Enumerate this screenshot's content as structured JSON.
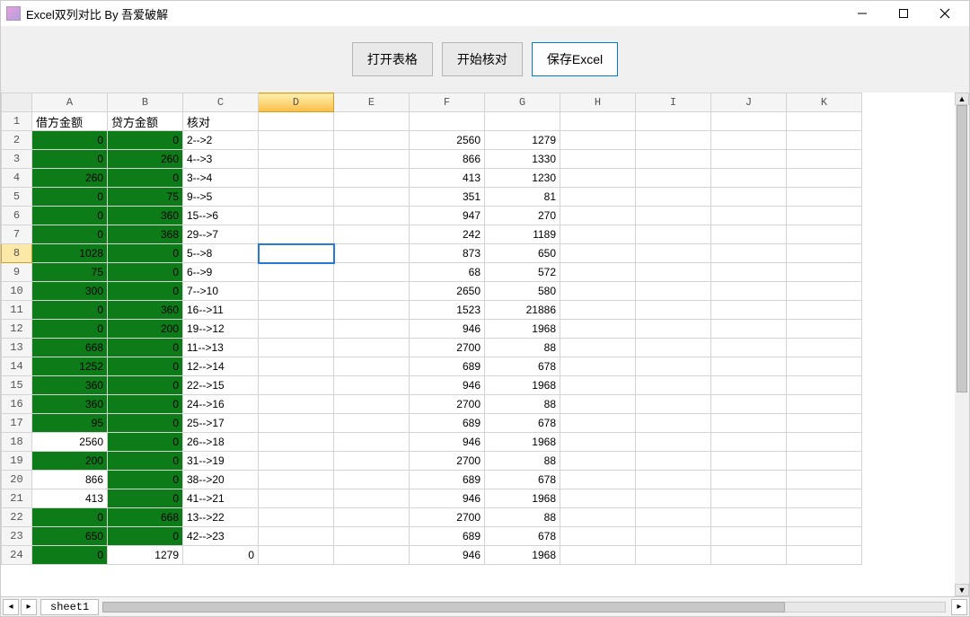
{
  "window": {
    "title": "Excel双列对比 By 吾爱破解"
  },
  "toolbar": {
    "open_label": "打开表格",
    "compare_label": "开始核对",
    "save_label": "保存Excel"
  },
  "grid": {
    "columns": [
      "A",
      "B",
      "C",
      "D",
      "E",
      "F",
      "G",
      "H",
      "I",
      "J",
      "K"
    ],
    "selected_col": "D",
    "selected_row": 8,
    "headers_row": {
      "A": "借方金额",
      "B": "贷方金额",
      "C": "核对"
    },
    "rows": [
      {
        "n": 2,
        "A": {
          "v": "0",
          "fill": "green"
        },
        "B": {
          "v": "0",
          "fill": "green"
        },
        "C": "2-->2",
        "F": "2560",
        "G": "1279"
      },
      {
        "n": 3,
        "A": {
          "v": "0",
          "fill": "green"
        },
        "B": {
          "v": "260",
          "fill": "green"
        },
        "C": "4-->3",
        "F": "866",
        "G": "1330"
      },
      {
        "n": 4,
        "A": {
          "v": "260",
          "fill": "green"
        },
        "B": {
          "v": "0",
          "fill": "green"
        },
        "C": "3-->4",
        "F": "413",
        "G": "1230"
      },
      {
        "n": 5,
        "A": {
          "v": "0",
          "fill": "green"
        },
        "B": {
          "v": "75",
          "fill": "green"
        },
        "C": "9-->5",
        "F": "351",
        "G": "81"
      },
      {
        "n": 6,
        "A": {
          "v": "0",
          "fill": "green"
        },
        "B": {
          "v": "360",
          "fill": "green"
        },
        "C": "15-->6",
        "F": "947",
        "G": "270"
      },
      {
        "n": 7,
        "A": {
          "v": "0",
          "fill": "green"
        },
        "B": {
          "v": "368",
          "fill": "green"
        },
        "C": "29-->7",
        "F": "242",
        "G": "1189"
      },
      {
        "n": 8,
        "A": {
          "v": "1028",
          "fill": "green"
        },
        "B": {
          "v": "0",
          "fill": "green"
        },
        "C": "5-->8",
        "F": "873",
        "G": "650"
      },
      {
        "n": 9,
        "A": {
          "v": "75",
          "fill": "green"
        },
        "B": {
          "v": "0",
          "fill": "green"
        },
        "C": "6-->9",
        "F": "68",
        "G": "572"
      },
      {
        "n": 10,
        "A": {
          "v": "300",
          "fill": "green"
        },
        "B": {
          "v": "0",
          "fill": "green"
        },
        "C": "7-->10",
        "F": "2650",
        "G": "580"
      },
      {
        "n": 11,
        "A": {
          "v": "0",
          "fill": "green"
        },
        "B": {
          "v": "360",
          "fill": "green"
        },
        "C": "16-->11",
        "F": "1523",
        "G": "21886"
      },
      {
        "n": 12,
        "A": {
          "v": "0",
          "fill": "green"
        },
        "B": {
          "v": "200",
          "fill": "green"
        },
        "C": "19-->12",
        "F": "946",
        "G": "1968"
      },
      {
        "n": 13,
        "A": {
          "v": "668",
          "fill": "green"
        },
        "B": {
          "v": "0",
          "fill": "green"
        },
        "C": "11-->13",
        "F": "2700",
        "G": "88"
      },
      {
        "n": 14,
        "A": {
          "v": "1252",
          "fill": "green"
        },
        "B": {
          "v": "0",
          "fill": "green"
        },
        "C": "12-->14",
        "F": "689",
        "G": "678"
      },
      {
        "n": 15,
        "A": {
          "v": "360",
          "fill": "green"
        },
        "B": {
          "v": "0",
          "fill": "green"
        },
        "C": "22-->15",
        "F": "946",
        "G": "1968"
      },
      {
        "n": 16,
        "A": {
          "v": "360",
          "fill": "green"
        },
        "B": {
          "v": "0",
          "fill": "green"
        },
        "C": "24-->16",
        "F": "2700",
        "G": "88"
      },
      {
        "n": 17,
        "A": {
          "v": "95",
          "fill": "green"
        },
        "B": {
          "v": "0",
          "fill": "green"
        },
        "C": "25-->17",
        "F": "689",
        "G": "678"
      },
      {
        "n": 18,
        "A": {
          "v": "2560",
          "fill": "white"
        },
        "B": {
          "v": "0",
          "fill": "green"
        },
        "C": "26-->18",
        "F": "946",
        "G": "1968"
      },
      {
        "n": 19,
        "A": {
          "v": "200",
          "fill": "green"
        },
        "B": {
          "v": "0",
          "fill": "green"
        },
        "C": "31-->19",
        "F": "2700",
        "G": "88"
      },
      {
        "n": 20,
        "A": {
          "v": "866",
          "fill": "white"
        },
        "B": {
          "v": "0",
          "fill": "green"
        },
        "C": "38-->20",
        "F": "689",
        "G": "678"
      },
      {
        "n": 21,
        "A": {
          "v": "413",
          "fill": "white"
        },
        "B": {
          "v": "0",
          "fill": "green"
        },
        "C": "41-->21",
        "F": "946",
        "G": "1968"
      },
      {
        "n": 22,
        "A": {
          "v": "0",
          "fill": "green"
        },
        "B": {
          "v": "668",
          "fill": "green"
        },
        "C": "13-->22",
        "F": "2700",
        "G": "88"
      },
      {
        "n": 23,
        "A": {
          "v": "650",
          "fill": "green"
        },
        "B": {
          "v": "0",
          "fill": "green"
        },
        "C": "42-->23",
        "F": "689",
        "G": "678"
      },
      {
        "n": 24,
        "A": {
          "v": "0",
          "fill": "green"
        },
        "B": {
          "v": "1279",
          "fill": "white"
        },
        "C": "0",
        "F": "946",
        "G": "1968"
      }
    ]
  },
  "footer": {
    "sheet_tab": "sheet1"
  }
}
